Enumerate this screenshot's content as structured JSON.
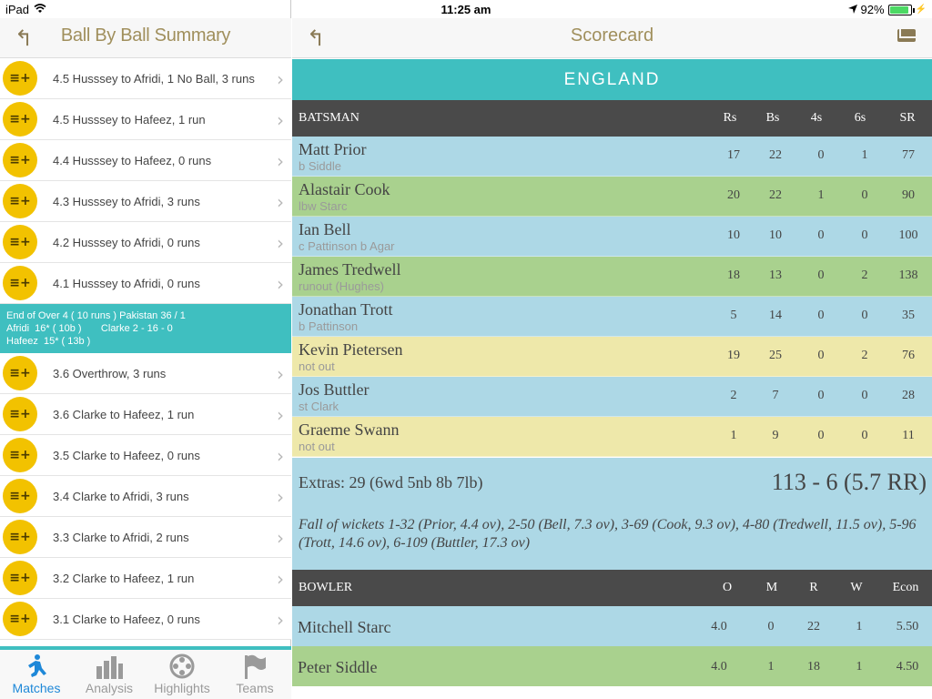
{
  "status_bar": {
    "device": "iPad",
    "time": "11:25 am",
    "battery": "92%",
    "battery_level": 0.92
  },
  "left_pane": {
    "title": "Ball By Ball Summary",
    "balls_before": [
      {
        "text": "4.5  Husssey to Afridi, 1 No Ball, 3 runs"
      },
      {
        "text": "4.5  Husssey to Hafeez, 1 run"
      },
      {
        "text": "4.4  Husssey to Hafeez, 0 runs"
      },
      {
        "text": "4.3  Husssey to Afridi, 3 runs"
      },
      {
        "text": "4.2  Husssey to Afridi, 0 runs"
      },
      {
        "text": "4.1  Husssey to Afridi, 0 runs"
      }
    ],
    "over_summary": {
      "line1": "End of Over 4 ( 10 runs ) Pakistan 36 / 1",
      "line2": "Afridi  16* ( 10b )       Clarke 2 - 16 - 0",
      "line3": "Hafeez  15* ( 13b )"
    },
    "balls_after": [
      {
        "text": "3.6  Overthrow, 3 runs"
      },
      {
        "text": "3.6  Clarke to Hafeez, 1 run"
      },
      {
        "text": "3.5  Clarke to Hafeez, 0 runs"
      },
      {
        "text": "3.4  Clarke to Afridi, 3 runs"
      },
      {
        "text": "3.3  Clarke to Afridi, 2 runs"
      },
      {
        "text": "3.2  Clarke to Hafeez, 1 run"
      },
      {
        "text": "3.1  Clarke to Hafeez, 0 runs"
      }
    ],
    "ball_icon_glyph": "≡+"
  },
  "tabs": [
    {
      "label": "Matches",
      "icon": "cricketer-icon",
      "active": true
    },
    {
      "label": "Analysis",
      "icon": "bar-chart-icon",
      "active": false
    },
    {
      "label": "Highlights",
      "icon": "film-reel-icon",
      "active": false
    },
    {
      "label": "Teams",
      "icon": "flag-icon",
      "active": false
    }
  ],
  "scorecard": {
    "title": "Scorecard",
    "team": "ENGLAND",
    "batting_headers": {
      "name": "BATSMAN",
      "rs": "Rs",
      "bs": "Bs",
      "fours": "4s",
      "sixes": "6s",
      "sr": "SR"
    },
    "batsmen": [
      {
        "name": "Matt Prior",
        "dismissal": "b Siddle",
        "rs": "17",
        "bs": "22",
        "fours": "0",
        "sixes": "1",
        "sr": "77",
        "color": "blue"
      },
      {
        "name": "Alastair Cook",
        "dismissal": "lbw Starc",
        "rs": "20",
        "bs": "22",
        "fours": "1",
        "sixes": "0",
        "sr": "90",
        "color": "green"
      },
      {
        "name": "Ian Bell",
        "dismissal": "c Pattinson b Agar",
        "rs": "10",
        "bs": "10",
        "fours": "0",
        "sixes": "0",
        "sr": "100",
        "color": "blue"
      },
      {
        "name": "James Tredwell",
        "dismissal": "runout (Hughes)",
        "rs": "18",
        "bs": "13",
        "fours": "0",
        "sixes": "2",
        "sr": "138",
        "color": "green"
      },
      {
        "name": "Jonathan Trott",
        "dismissal": "b Pattinson",
        "rs": "5",
        "bs": "14",
        "fours": "0",
        "sixes": "0",
        "sr": "35",
        "color": "blue"
      },
      {
        "name": "Kevin Pietersen",
        "dismissal": "not out",
        "rs": "19",
        "bs": "25",
        "fours": "0",
        "sixes": "2",
        "sr": "76",
        "color": "yellow"
      },
      {
        "name": "Jos Buttler",
        "dismissal": "st Clark",
        "rs": "2",
        "bs": "7",
        "fours": "0",
        "sixes": "0",
        "sr": "28",
        "color": "blue"
      },
      {
        "name": "Graeme Swann",
        "dismissal": "not out",
        "rs": "1",
        "bs": "9",
        "fours": "0",
        "sixes": "0",
        "sr": "11",
        "color": "yellow"
      }
    ],
    "extras": "Extras: 29 (6wd 5nb 8b 7lb)",
    "total": "113 - 6 (5.7 RR)",
    "fall_of_wickets": "Fall of wickets 1-32 (Prior, 4.4 ov), 2-50 (Bell, 7.3 ov), 3-69 (Cook, 9.3 ov), 4-80 (Tredwell, 11.5 ov), 5-96 (Trott, 14.6 ov), 6-109 (Buttler, 17.3 ov)",
    "bowling_headers": {
      "name": "BOWLER",
      "o": "O",
      "m": "M",
      "r": "R",
      "w": "W",
      "econ": "Econ"
    },
    "bowlers": [
      {
        "name": "Mitchell Starc",
        "o": "4.0",
        "m": "0",
        "r": "22",
        "w": "1",
        "econ": "5.50",
        "color": "blue"
      },
      {
        "name": "Peter Siddle",
        "o": "4.0",
        "m": "1",
        "r": "18",
        "w": "1",
        "econ": "4.50",
        "color": "green"
      }
    ]
  },
  "colors": {
    "accent_teal": "#3fbfc0",
    "ball_icon_yellow": "#f2c200",
    "row_blue": "#add8e6",
    "row_green": "#a9d18e",
    "row_yellow": "#eee8aa",
    "header_dark": "#4a4a4a",
    "title_gold": "#a08f5c",
    "tab_active": "#1e88d8"
  }
}
